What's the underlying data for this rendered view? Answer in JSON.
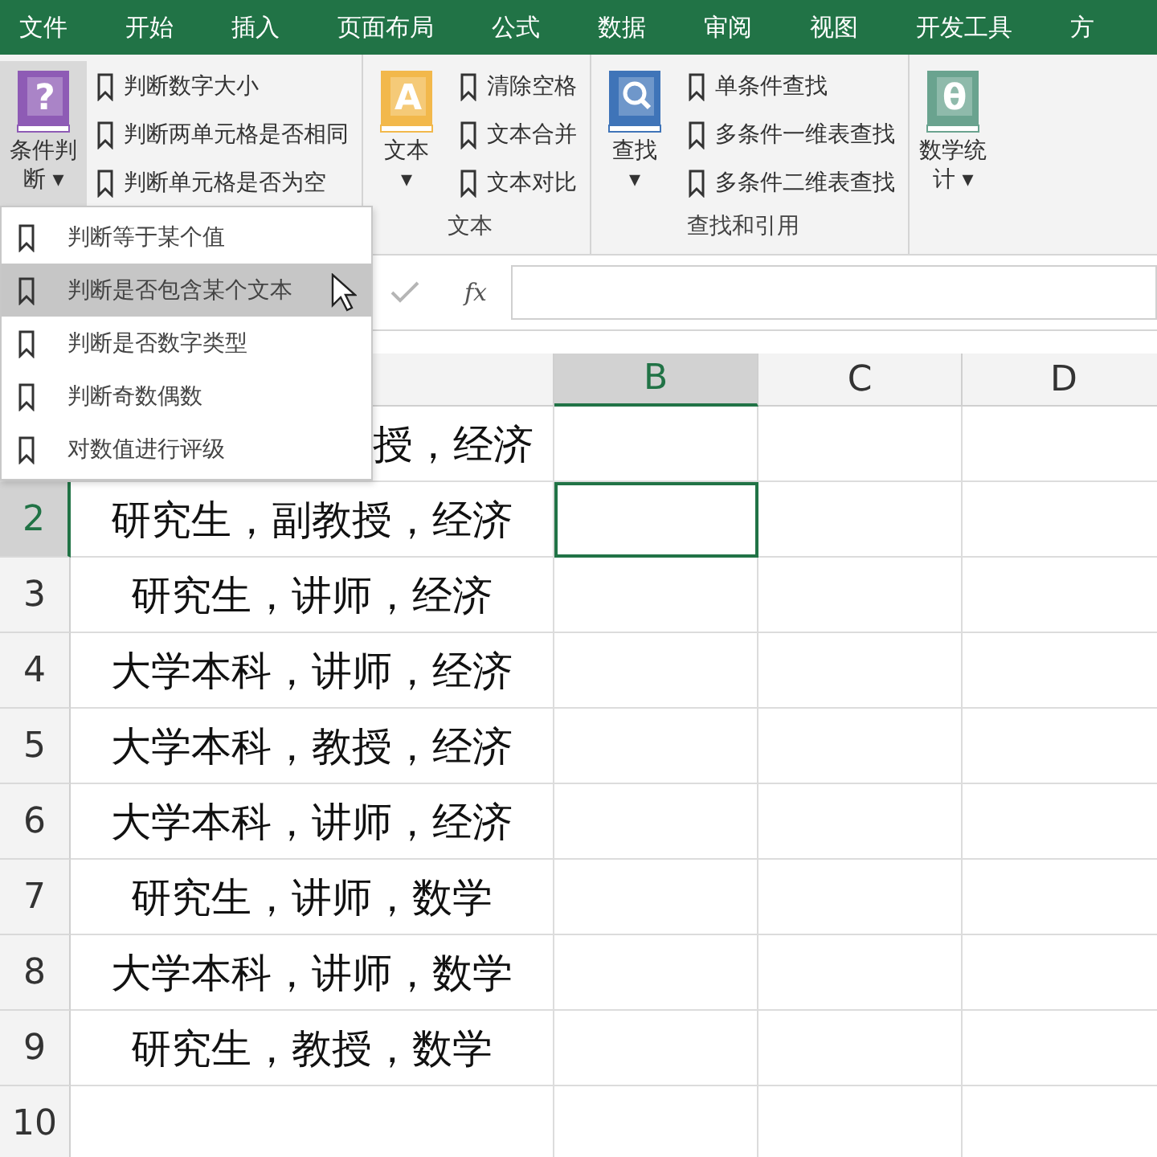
{
  "tabs": [
    {
      "label": "文件"
    },
    {
      "label": "开始"
    },
    {
      "label": "插入"
    },
    {
      "label": "页面布局"
    },
    {
      "label": "公式"
    },
    {
      "label": "数据"
    },
    {
      "label": "审阅"
    },
    {
      "label": "视图"
    },
    {
      "label": "开发工具"
    },
    {
      "label": "方"
    }
  ],
  "ribbon": {
    "groups": [
      {
        "big_button": {
          "label": "条件判断",
          "glyph": "?",
          "caret": "▾",
          "color": "#8e5bb5",
          "pressed": true
        },
        "items": [
          "判断数字大小",
          "判断两单元格是否相同",
          "判断单元格是否为空"
        ]
      },
      {
        "label": "文本",
        "big_button": {
          "label": "文本",
          "glyph": "A",
          "caret": "▾",
          "color": "#f2b84b",
          "pressed": false
        },
        "items": [
          "清除空格",
          "文本合并",
          "文本对比"
        ]
      },
      {
        "label": "查找和引用",
        "big_button": {
          "label": "查找",
          "caret": "▾",
          "color": "#3f74b8",
          "pressed": false
        },
        "items": [
          "单条件查找",
          "多条件一维表查找",
          "多条件二维表查找"
        ]
      },
      {
        "big_button": {
          "label": "数学统计",
          "glyph": "θ",
          "caret": "▾",
          "color": "#6aa38f",
          "pressed": false
        }
      }
    ]
  },
  "menu": {
    "items": [
      {
        "label": "判断等于某个值",
        "selected": false
      },
      {
        "label": "判断是否包含某个文本",
        "selected": true
      },
      {
        "label": "判断是否数字类型",
        "selected": false
      },
      {
        "label": "判断奇数偶数",
        "selected": false
      },
      {
        "label": "对数值进行评级",
        "selected": false
      }
    ]
  },
  "formula_bar": {
    "fx": "fx"
  },
  "sheet": {
    "columns": [
      {
        "label": "B",
        "selected": true
      },
      {
        "label": "C",
        "selected": false
      },
      {
        "label": "D",
        "selected": false
      }
    ],
    "rows": [
      {
        "text": "授，经济",
        "selected": false
      },
      {
        "number": "2",
        "text": "研究生，副教授，经济",
        "selected": true
      },
      {
        "number": "3",
        "text": "研究生，讲师，经济",
        "selected": false
      },
      {
        "number": "4",
        "text": "大学本科，讲师，经济",
        "selected": false
      },
      {
        "number": "5",
        "text": "大学本科，教授，经济",
        "selected": false
      },
      {
        "number": "6",
        "text": "大学本科，讲师，经济",
        "selected": false
      },
      {
        "number": "7",
        "text": "研究生，讲师，数学",
        "selected": false
      },
      {
        "number": "8",
        "text": "大学本科，讲师，数学",
        "selected": false
      },
      {
        "number": "9",
        "text": "研究生，教授，数学",
        "selected": false
      },
      {
        "number": "10",
        "selected": false
      }
    ]
  }
}
